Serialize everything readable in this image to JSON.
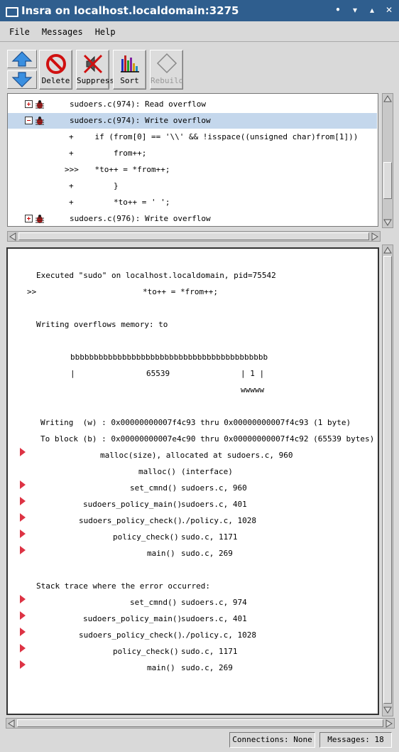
{
  "window": {
    "title": "Insra on localhost.localdomain:3275"
  },
  "menubar": {
    "items": [
      "File",
      "Messages",
      "Help"
    ]
  },
  "toolbar": {
    "delete_label": "Delete",
    "suppress_label": "Suppress",
    "sort_label": "Sort",
    "rebuild_label": "Rebuild"
  },
  "list": {
    "rows": [
      {
        "text": "sudoers.c(974): Read overflow",
        "expander": "plus",
        "selected": false
      },
      {
        "text": "sudoers.c(974): Write overflow",
        "expander": "minus",
        "selected": true
      },
      {
        "mark": "+",
        "text": "    if (from[0] == '\\\\' && !isspace((unsigned char)from[1]))"
      },
      {
        "mark": "+",
        "text": "        from++;"
      },
      {
        "mark": ">>>",
        "text": "    *to++ = *from++;"
      },
      {
        "mark": "+",
        "text": "        }"
      },
      {
        "mark": "+",
        "text": "        *to++ = ' ';"
      },
      {
        "text": "sudoers.c(976): Write overflow",
        "expander": "plus",
        "selected": false
      }
    ]
  },
  "detail": {
    "executed": "Executed \"sudo\" on localhost.localdomain, pid=75542",
    "marker": ">>",
    "marker_code": "*to++ = *from++;",
    "writing_heading": "Writing overflows memory: to",
    "memory_b": "bbbbbbbbbbbbbbbbbbbbbbbbbbbbbbbbbbbbbbbbbb",
    "memory_pipe_left": "|",
    "memory_size": "65539",
    "memory_pipe_right": "| 1 |",
    "memory_w": "wwwww",
    "writing_range": "Writing  (w) : 0x00000000007f4c93 thru 0x00000000007f4c93 (1 byte)",
    "block_range": "To block (b) : 0x00000000007e4c90 thru 0x00000000007f4c92 (65539 bytes)",
    "alloc_frames": [
      {
        "fn": "malloc(size), allocated at sudoers.c, 960",
        "loc": "",
        "arrow": true
      },
      {
        "fn": "malloc()",
        "loc": "(interface)",
        "arrow": false
      },
      {
        "fn": "set_cmnd()",
        "loc": "sudoers.c, 960",
        "arrow": true
      },
      {
        "fn": "sudoers_policy_main()",
        "loc": "sudoers.c, 401",
        "arrow": true
      },
      {
        "fn": "sudoers_policy_check()",
        "loc": "./policy.c, 1028",
        "arrow": true
      },
      {
        "fn": "policy_check()",
        "loc": "sudo.c, 1171",
        "arrow": true
      },
      {
        "fn": "main()",
        "loc": "sudo.c, 269",
        "arrow": true
      }
    ],
    "stack_heading": "Stack trace where the error occurred:",
    "stack_frames": [
      {
        "fn": "set_cmnd()",
        "loc": "sudoers.c, 974"
      },
      {
        "fn": "sudoers_policy_main()",
        "loc": "sudoers.c, 401"
      },
      {
        "fn": "sudoers_policy_check()",
        "loc": "./policy.c, 1028"
      },
      {
        "fn": "policy_check()",
        "loc": "sudo.c, 1171"
      },
      {
        "fn": "main()",
        "loc": "sudo.c, 269"
      }
    ]
  },
  "status": {
    "connections": "Connections: None",
    "messages": "Messages: 18"
  },
  "colors": {
    "titlebar": "#2f5e8e",
    "selection": "#c4d7ec",
    "frame_arrow": "#d34"
  }
}
